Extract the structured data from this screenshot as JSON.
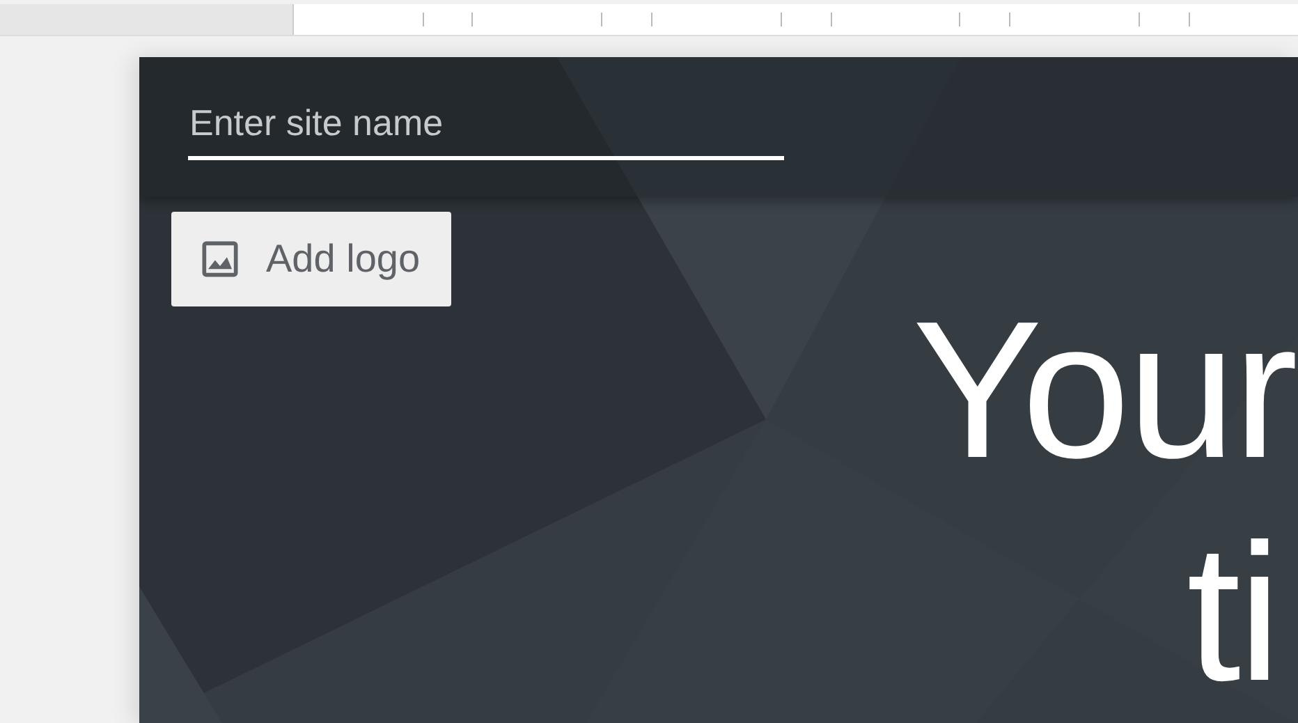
{
  "header": {
    "site_name": {
      "placeholder": "Enter site name"
    }
  },
  "logo_button": {
    "label": "Add logo"
  },
  "page_title": {
    "lines": [
      "Your",
      "ti"
    ]
  }
}
